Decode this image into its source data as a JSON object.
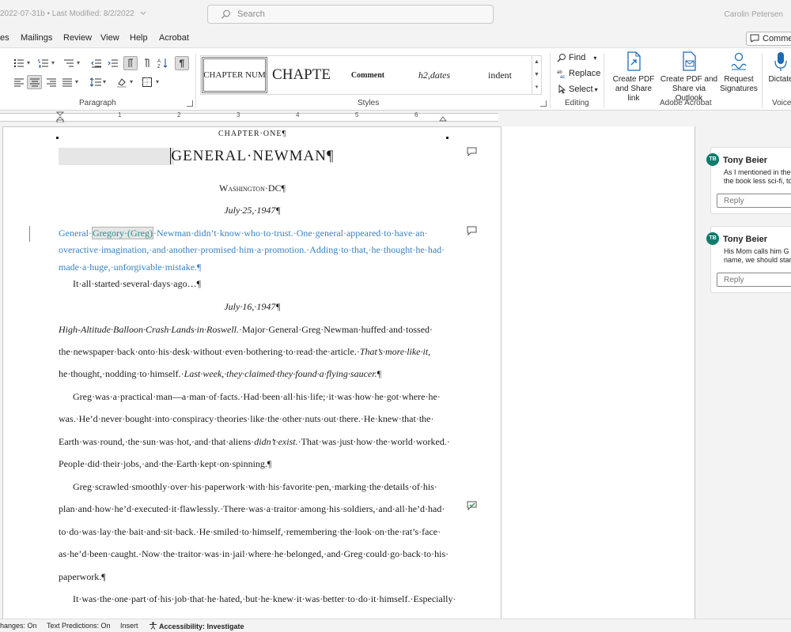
{
  "titlebar": {
    "doc_title": "2022-07-31b",
    "modified": "Last Modified: 8/2/2022",
    "search_placeholder": "Search",
    "user": "Carolin Petersen"
  },
  "tabs": [
    {
      "label": "es"
    },
    {
      "label": "Mailings"
    },
    {
      "label": "Review"
    },
    {
      "label": "View"
    },
    {
      "label": "Help"
    },
    {
      "label": "Acrobat"
    }
  ],
  "comments_button": "Comments",
  "ribbon": {
    "groups": {
      "paragraph": "Paragraph",
      "styles": "Styles",
      "editing": "Editing",
      "adobe": "Adobe Acrobat",
      "voice": "Voice"
    },
    "styles": [
      {
        "label": "CHAPTER NUM"
      },
      {
        "label": "CHAPTE"
      },
      {
        "label": "Comment"
      },
      {
        "label": "h2,dates"
      },
      {
        "label": "indent"
      }
    ],
    "editing": {
      "find": "Find",
      "replace": "Replace",
      "select": "Select"
    },
    "adobe": {
      "create_pdf": [
        "Create PDF",
        "and Share link"
      ],
      "create_pdf_outlook": [
        "Create PDF and",
        "Share via Outlook"
      ],
      "request_signatures": [
        "Request",
        "Signatures"
      ]
    },
    "voice": {
      "dictate": "Dictate"
    }
  },
  "ruler": [
    "1",
    "2",
    "3",
    "4",
    "5",
    "6"
  ],
  "document": {
    "chapter": "CHAPTER·ONE¶",
    "title": "GENERAL·NEWMAN¶",
    "location": "Washington·DC¶",
    "date1": "July·25,·1947¶",
    "para1": {
      "l1_pre": "General·",
      "l1_hl": "Gregory·(Greg)",
      "l1_post": "·Newman·didn’t·know·who·to·trust.·One·general·appeared·to·have·an·",
      "l2": "overactive·imagination,·and·another·promised·him·a·promotion.·Adding·to·that,·he·thought·he·had·",
      "l3": "made·a·huge,·unforgivable·mistake.¶"
    },
    "para2": "It·all·started·several·days·ago…¶",
    "date2": "July·16,·1947¶",
    "para3": {
      "l1_it": "High-Altitude·Balloon·Crash·Lands·in·Roswell.",
      "l1_rest": "·Major·General·Greg·Newman·huffed·and·tossed·",
      "l2_pre": "the·newspaper·back·onto·his·desk·without·even·bothering·to·read·the·article.·",
      "l2_it": "That’s·more·like·it,",
      "l3_pre": "he·thought,·nodding·to·himself.·",
      "l3_it": "Last·week,·they·claimed·they·found·a·flying·saucer.",
      "l3_post": "¶"
    },
    "para4": {
      "l1": "Greg·was·a·practical·man—a·man·of·facts.·Had·been·all·his·life;·it·was·how·he·got·where·he·",
      "l2": "was.·He’d·never·bought·into·conspiracy·theories·like·the·other·nuts·out·there.·He·knew·that·the·",
      "l3_pre": "Earth·was·round,·the·sun·was·hot,·and·that·aliens·",
      "l3_it": "didn’t·exist.",
      "l3_post": "·That·was·just·how·the·world·worked.·",
      "l4": "People·did·their·jobs,·and·the·Earth·kept·on·spinning.¶"
    },
    "para5": {
      "l1": "Greg·scrawled·smoothly·over·his·paperwork·with·his·favorite·pen,·marking·the·details·of·his·",
      "l2": "plan·and·how·he’d·executed·it·flawlessly.·There·was·a·traitor·among·his·soldiers,·and·all·he’d·had·",
      "l3": "to·do·was·lay·the·bait·and·sit·back.·He·smiled·to·himself,·remembering·the·look·on·the·rat’s·face·",
      "l4": "as·he’d·been·caught.·Now·the·traitor·was·in·jail·where·he·belonged,·and·Greg·could·go·back·to·his·",
      "l5": "paperwork.¶"
    },
    "para6": "It·was·the·one·part·of·his·job·that·he·hated,·but·he·knew·it·was·better·to·do·it·himself.·Especially·"
  },
  "comments": [
    {
      "initials": "TB",
      "author": "Tony Beier",
      "lines": [
        "As I mentioned in the",
        "the book less sci-fi, to"
      ],
      "reply": "Reply"
    },
    {
      "initials": "TB",
      "author": "Tony Beier",
      "lines": [
        "His Mom calls him G",
        "name, we should star"
      ],
      "reply": "Reply"
    }
  ],
  "status": {
    "track_changes": "hanges: On",
    "text_predictions": "Text Predictions: On",
    "insert": "Insert",
    "accessibility": "Accessibility: Investigate"
  }
}
